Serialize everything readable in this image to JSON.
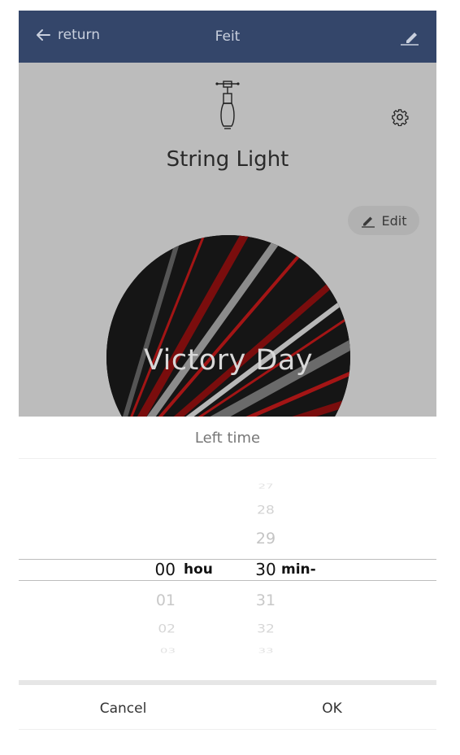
{
  "header": {
    "back_label": "return",
    "title": "Feit",
    "background": "#34466a"
  },
  "device": {
    "name": "String Light",
    "edit_label": "Edit",
    "scene_label": "Victory Day",
    "icons": [
      "bulb-icon",
      "gear-icon",
      "pencil-icon"
    ]
  },
  "sheet": {
    "title": "Left time",
    "hours": {
      "above": [
        "",
        "",
        ""
      ],
      "selected": "00",
      "below": [
        "01",
        "02",
        "03"
      ],
      "unit": "hou"
    },
    "minutes": {
      "above": [
        "27",
        "28",
        "29"
      ],
      "selected": "30",
      "below": [
        "31",
        "32",
        "33"
      ],
      "unit": "min-"
    },
    "cancel_label": "Cancel",
    "ok_label": "OK"
  }
}
